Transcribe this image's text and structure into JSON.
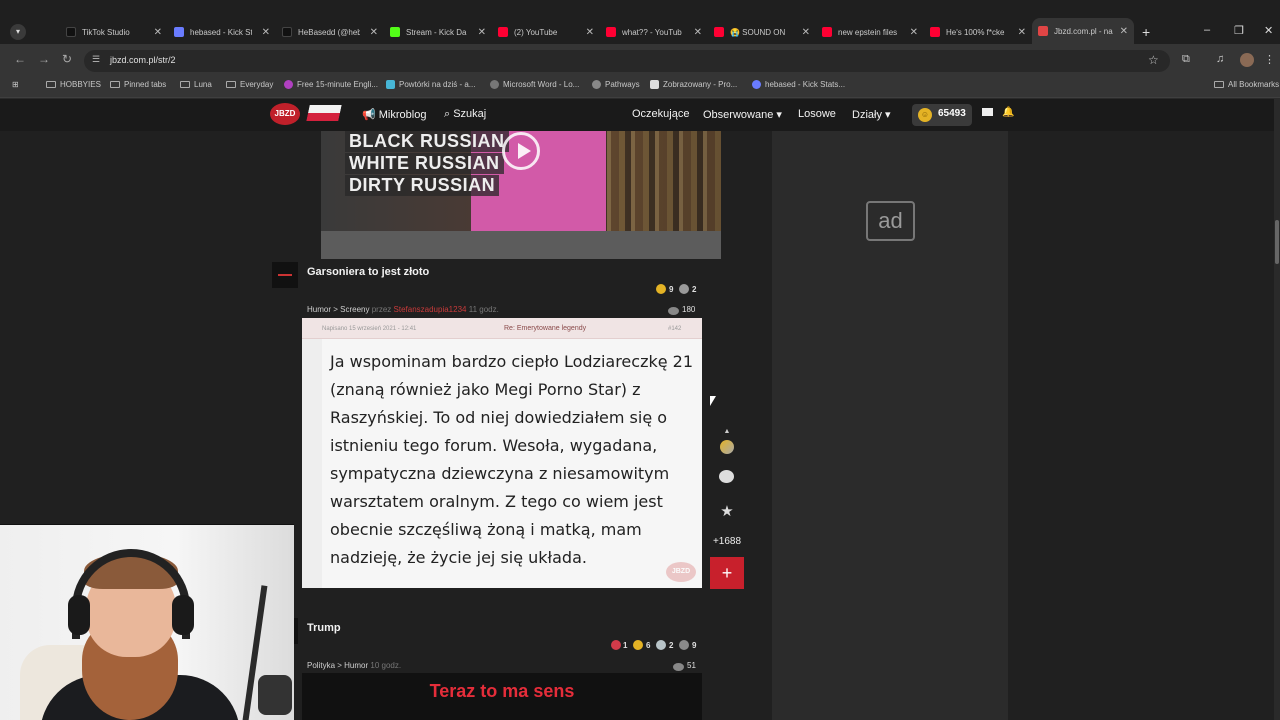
{
  "browser": {
    "tabs": [
      {
        "label": "TikTok Studio",
        "color": "#111111"
      },
      {
        "label": "hebased - Kick St",
        "color": "#6a7cff"
      },
      {
        "label": "HeBasedd (@heb",
        "color": "#111111"
      },
      {
        "label": "Stream - Kick Da",
        "color": "#53fc18"
      },
      {
        "label": "(2) YouTube",
        "color": "#ff0033"
      },
      {
        "label": "what?? - YouTub",
        "color": "#ff0033"
      },
      {
        "label": "😭 SOUND ON",
        "color": "#ff0033"
      },
      {
        "label": "new epstein files",
        "color": "#ff0033"
      },
      {
        "label": "He's 100% f*cke",
        "color": "#ff0033"
      },
      {
        "label": "Jbzd.com.pl - na",
        "color": "#e04545"
      }
    ],
    "url": "jbzd.com.pl/str/2",
    "bookmarks": [
      "HOBBYIES",
      "Pinned tabs",
      "Luna",
      "Everyday",
      "Free 15-minute Engli...",
      "Powtórki na dziś - a...",
      "Microsoft Word - Lo...",
      "Pathways",
      "Zobrazowany - Pro...",
      "hebased - Kick Stats..."
    ],
    "all_bookmarks": "All Bookmarks"
  },
  "header": {
    "logo": "JBZD",
    "mikroblog": "Mikroblog",
    "search": "Szukaj",
    "oczekujace": "Oczekujące",
    "obserwowane": "Obserwowane",
    "losowe": "Losowe",
    "dzialy": "Działy",
    "coins": "65493"
  },
  "ad_label": "ad",
  "video": {
    "lines": [
      "BLACK RUSSIAN",
      "WHITE RUSSIAN",
      "DIRTY RUSSIAN"
    ]
  },
  "post1": {
    "title": "Garsoniera to jest złoto",
    "medals": {
      "gold": "9",
      "silver": "2"
    },
    "category": "Humor",
    "subcategory": "Screeny",
    "by": "przez",
    "author": "Stefanszadupia1234",
    "age": "11 godz.",
    "comments": "180",
    "forum_date": "Napisano 15 wrzesień 2021 - 12:41",
    "forum_title": "Re: Emerytowane legendy",
    "forum_num": "#142",
    "quote": "Ja wspominam bardzo ciepło Lodziareczkę 21 (znaną również jako Megi Porno Star) z Raszyńskiej. To od niej dowiedziałem się o istnieniu tego forum. Wesoła, wygadana, sympatyczna dziewczyna z niesamowitym warsztatem oralnym. Z tego co wiem jest obecnie szczęśliwą żoną i matką, mam nadzieję, że życie jej się układa.",
    "watermark": "JBZD",
    "score": "+1688"
  },
  "post2": {
    "title": "Trump",
    "medals": {
      "red": "1",
      "gold": "6",
      "silver": "2",
      "gray": "9"
    },
    "category": "Polityka",
    "subcategory": "Humor",
    "age": "10 godz.",
    "comments": "51",
    "caption": "Teraz to ma sens"
  }
}
